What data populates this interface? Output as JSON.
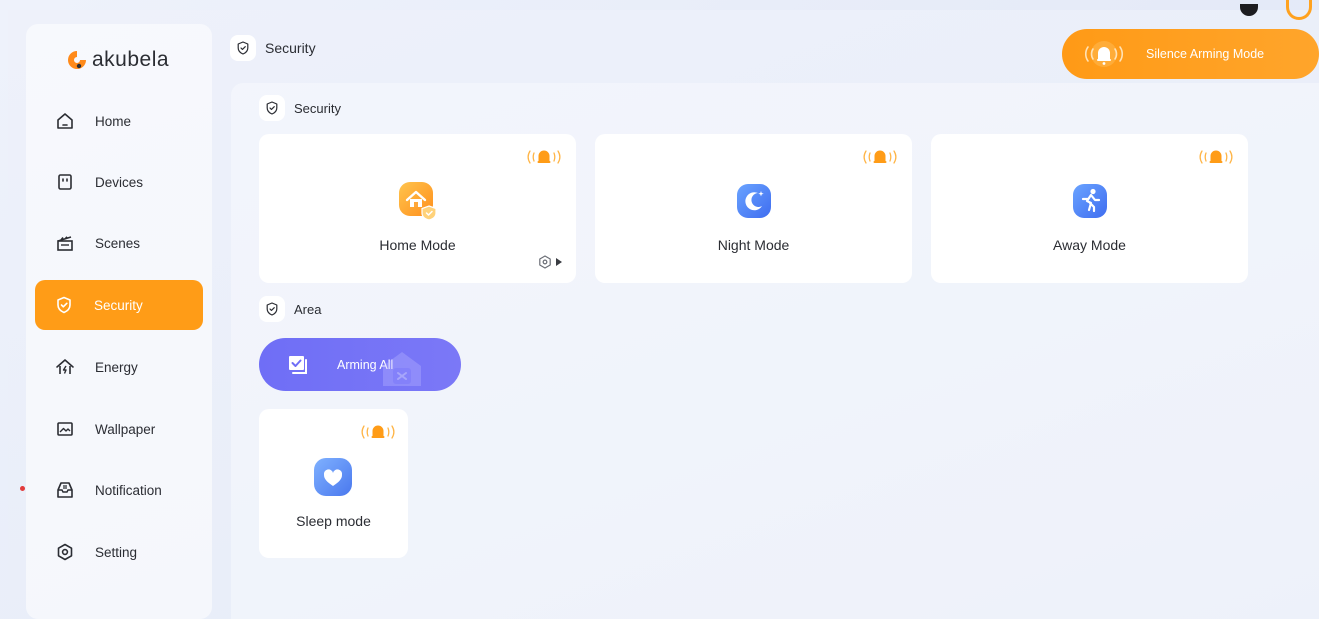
{
  "app": {
    "logo_text": "akubela",
    "brand_color": "#ff9c17",
    "accent_purple": "#6f6ef6"
  },
  "sidebar": {
    "items": [
      {
        "label": "Home",
        "icon": "home-icon"
      },
      {
        "label": "Devices",
        "icon": "device-icon"
      },
      {
        "label": "Scenes",
        "icon": "clapper-icon"
      },
      {
        "label": "Security",
        "icon": "shield-icon",
        "active": true
      },
      {
        "label": "Energy",
        "icon": "energy-house-icon"
      },
      {
        "label": "Wallpaper",
        "icon": "image-icon"
      },
      {
        "label": "Notification",
        "icon": "inbox-icon",
        "unread_dot": true
      },
      {
        "label": "Setting",
        "icon": "settings-hex-icon"
      }
    ]
  },
  "header": {
    "title": "Security",
    "silence_button": "Silence Arming Mode"
  },
  "main": {
    "security_section": "Security",
    "modes": [
      {
        "label": "Home Mode",
        "icon": "home-mode-icon",
        "has_settings": true
      },
      {
        "label": "Night Mode",
        "icon": "night-mode-icon"
      },
      {
        "label": "Away Mode",
        "icon": "away-mode-icon"
      }
    ],
    "area_section": "Area",
    "arming_all": "Arming All",
    "areas": [
      {
        "label": "Sleep mode",
        "icon": "sleep-mode-icon"
      }
    ]
  }
}
